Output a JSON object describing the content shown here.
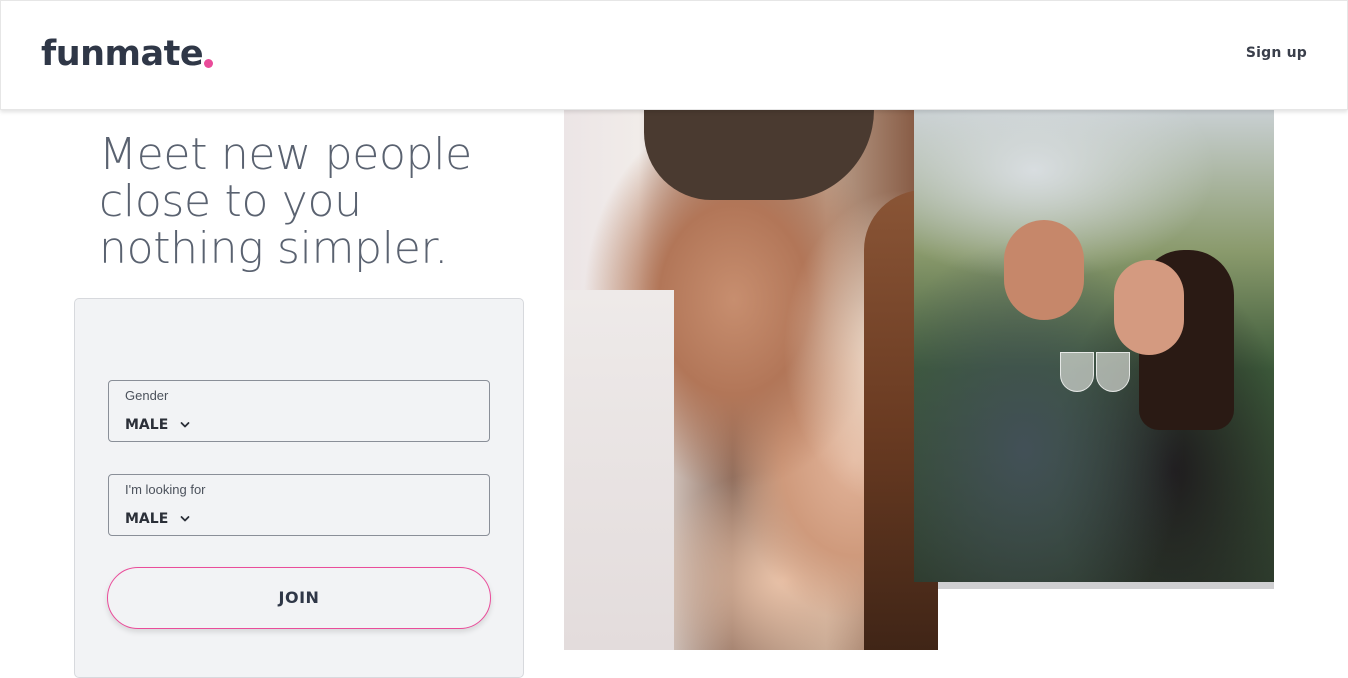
{
  "header": {
    "logo_text": "funmate",
    "logo_dot_color": "#ea4c9a",
    "signup_label": "Sign up"
  },
  "hero": {
    "headline_lines": [
      "Meet new people",
      "close to you",
      "nothing simpler."
    ]
  },
  "form": {
    "gender": {
      "label": "Gender",
      "value": "MALE",
      "icon": "chevron-down-icon"
    },
    "looking_for": {
      "label": "I'm looking for",
      "value": "MALE",
      "icon": "chevron-down-icon"
    },
    "join_label": "JOIN",
    "accent_color": "#ea4c9a"
  },
  "images": {
    "photo_left": "couple-forehead-touch-photo",
    "photo_right": "couple-toasting-wine-photo"
  }
}
